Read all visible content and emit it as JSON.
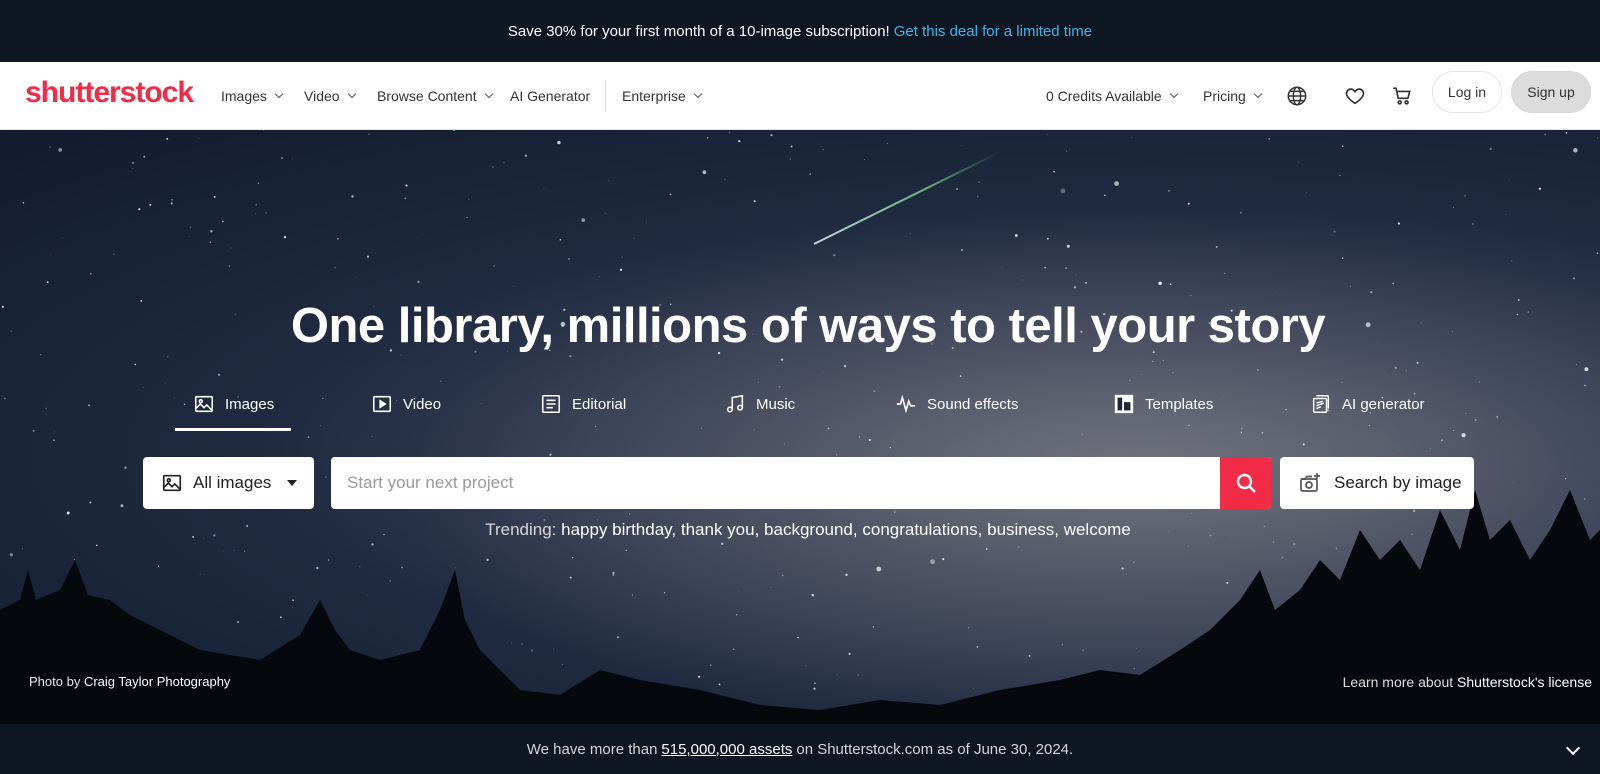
{
  "promo": {
    "text": "Save 30% for your first month of a 10-image subscription!",
    "link": "Get this deal for a limited time"
  },
  "header": {
    "logo": "shutterstock",
    "nav": {
      "images": "Images",
      "video": "Video",
      "browse": "Browse Content",
      "ai": "AI Generator",
      "enterprise": "Enterprise"
    },
    "credits": "0 Credits Available",
    "pricing": "Pricing",
    "login": "Log in",
    "signup": "Sign up"
  },
  "hero": {
    "headline": "One library, millions of ways to tell your story",
    "tabs": {
      "images": "Images",
      "video": "Video",
      "editorial": "Editorial",
      "music": "Music",
      "sound": "Sound effects",
      "templates": "Templates",
      "ai": "AI generator"
    },
    "search": {
      "type": "All images",
      "placeholder": "Start your next project",
      "by_image": "Search by image"
    },
    "trending": {
      "label": "Trending:",
      "terms": [
        "happy birthday,",
        "thank you,",
        "background,",
        "congratulations,",
        "business,",
        "welcome"
      ]
    },
    "credit": {
      "prefix": "Photo",
      "by": "by",
      "author": "Craig Taylor Photography"
    },
    "license": {
      "prefix": "Learn more about",
      "link": "Shutterstock's license"
    }
  },
  "footer": {
    "prefix": "We have more than",
    "assets": "515,000,000 assets",
    "suffix": "on Shutterstock.com as of June 30, 2024."
  },
  "colors": {
    "brand": "#f22c46",
    "promo_link": "#3fb3e8",
    "dark_bg": "#0e1621"
  }
}
